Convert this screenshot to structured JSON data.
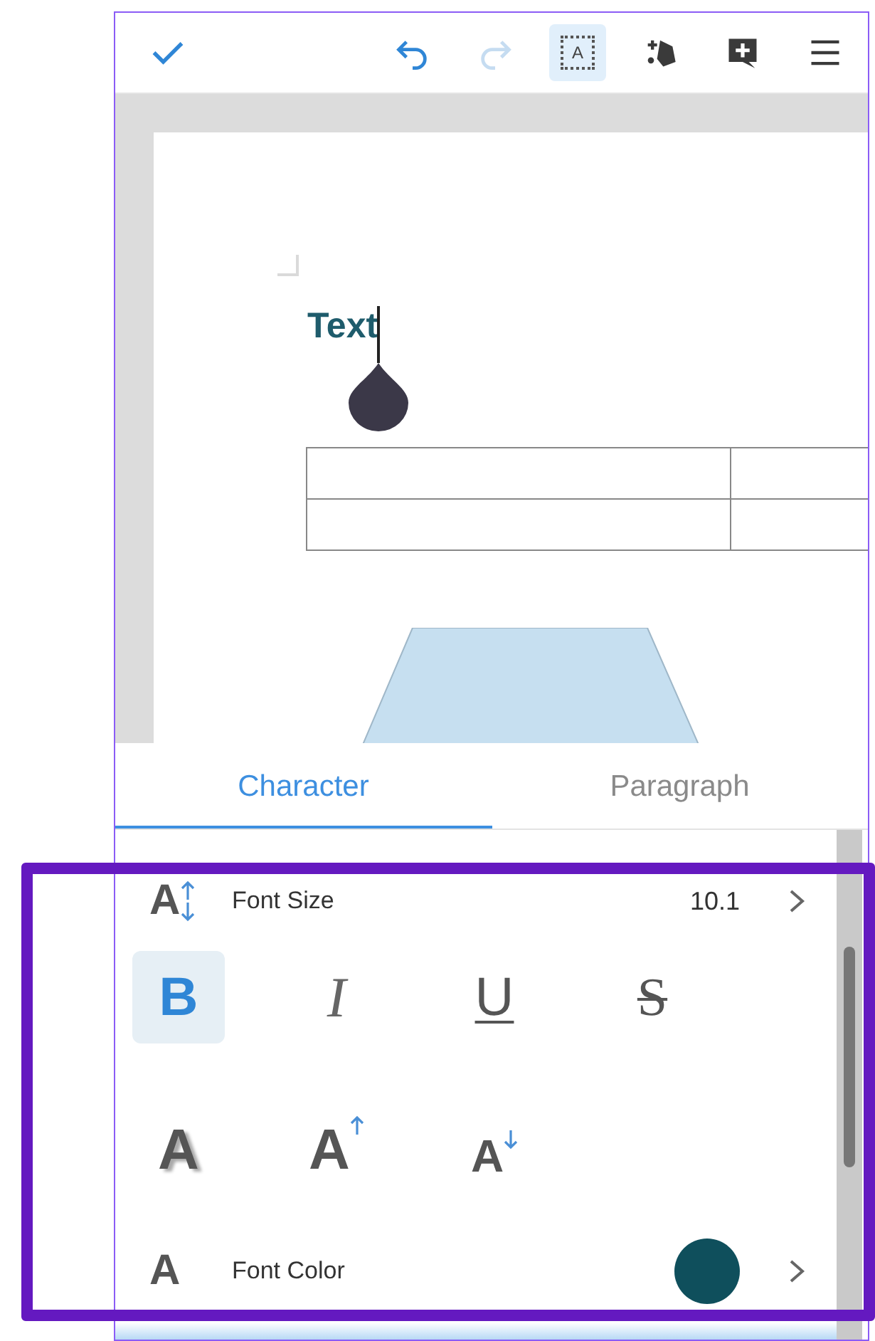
{
  "toolbar": {
    "buttons": [
      {
        "kind": "check",
        "disabled": false,
        "selected": false
      },
      {
        "kind": "undo",
        "disabled": false,
        "selected": false
      },
      {
        "kind": "redo",
        "disabled": true,
        "selected": false
      },
      {
        "kind": "textbox",
        "glyph": "A",
        "disabled": false,
        "selected": true
      },
      {
        "kind": "shapes",
        "disabled": false,
        "selected": false
      },
      {
        "kind": "comment",
        "disabled": false,
        "selected": false
      },
      {
        "kind": "menu",
        "disabled": false,
        "selected": false
      }
    ]
  },
  "document": {
    "text_box": "Text"
  },
  "tabs": [
    {
      "label": "Character",
      "selected": true
    },
    {
      "label": "Paragraph",
      "selected": false
    }
  ],
  "panel": {
    "font_size": {
      "glyph": "A",
      "label": "Font Size",
      "value": "10.1"
    },
    "styles": [
      {
        "kind": "bold",
        "glyph": "B",
        "selected": true
      },
      {
        "kind": "italic",
        "glyph": "I",
        "selected": false
      },
      {
        "kind": "underline",
        "glyph": "U",
        "selected": false
      },
      {
        "kind": "strikethrough",
        "glyph": "S",
        "selected": false
      }
    ],
    "effects": [
      {
        "kind": "shadow",
        "glyph": "A"
      },
      {
        "kind": "superscript",
        "glyph": "A"
      },
      {
        "kind": "subscript",
        "glyph": "A"
      }
    ],
    "font_color": {
      "glyph": "A",
      "label": "Font Color",
      "color": "#0f4f5c"
    }
  }
}
